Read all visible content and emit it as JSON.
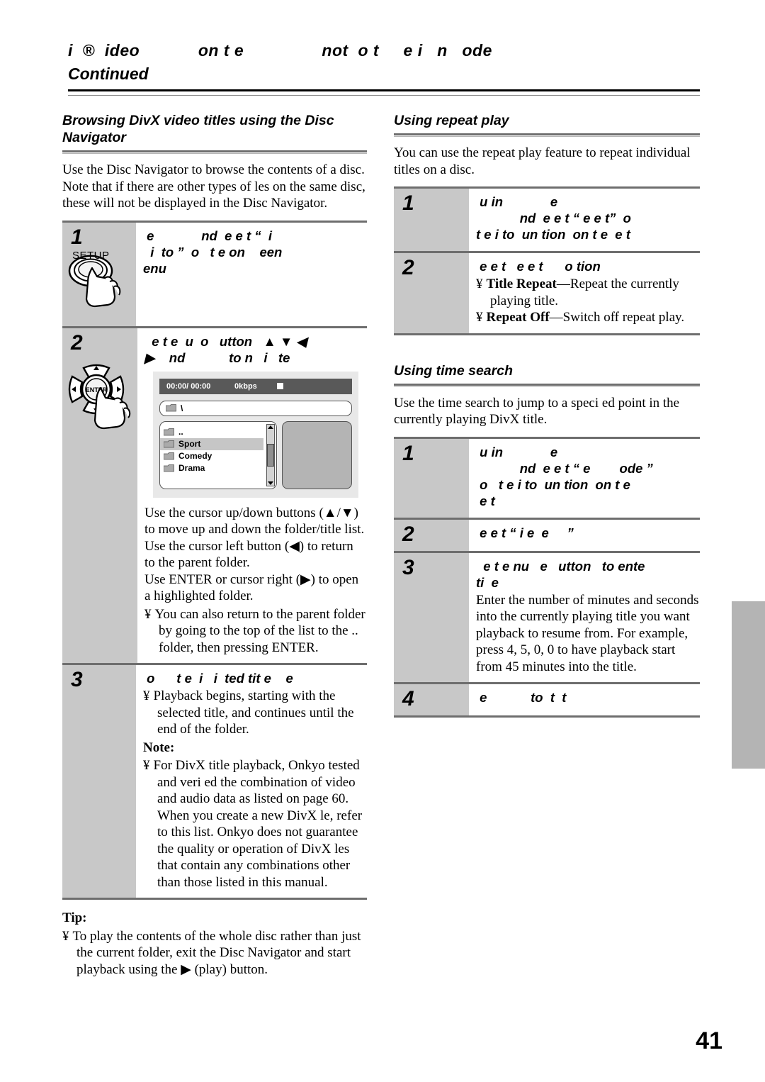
{
  "running_head": {
    "line1": "i  ®  ideo            on t e                not  o t     e i   n   ode",
    "line2": "Continued"
  },
  "left_column": {
    "section_title": "Browsing DivX video titles using the Disc Navigator",
    "intro": "Use the Disc Navigator to browse the contents of a disc. Note that if there are other types of  les on the same disc, these will not be displayed in the Disc Navigator.",
    "steps": [
      {
        "number": "1",
        "button_label": "SETUP",
        "instruction": " e             nd  e e t “  i\n  i  to ”  o   t e on    een\nenu"
      },
      {
        "number": "2",
        "instruction": "  e t e  u  o   utton   ▲ ▼ ◀\n▶    nd            to n   i   te",
        "osd": {
          "status_time": "00:00/ 00:00",
          "status_bitrate": "0kbps",
          "status_icon": "stop-icon",
          "path": "\\",
          "items": [
            {
              "label": "..",
              "selected": false
            },
            {
              "label": "Sport",
              "selected": true
            },
            {
              "label": "Comedy",
              "selected": false
            },
            {
              "label": "Drama",
              "selected": false
            }
          ]
        },
        "paragraphs": [
          "Use the cursor up/down buttons (▲/▼) to move up and down the folder/title list.",
          "Use the cursor left button (◀) to return to the parent folder.",
          "Use ENTER or cursor right (▶) to open a highlighted folder."
        ],
        "bullets": [
          "You can also return to the top of the list to the  .. folder, then pressing ENTER."
        ],
        "bullets_real": [
          "You can also return to the parent folder by going to the top of the list to the  .. folder, then pressing ENTER."
        ]
      },
      {
        "number": "3",
        "instruction": " o      t e  i   i  ted tit e    e",
        "bullets": [
          "Playback begins, starting with the selected title, and continues until the end of the folder."
        ],
        "note_heading": "Note:",
        "note_bullets": [
          "For DivX title playback, Onkyo tested and veri  ed the combination of video and audio data as listed on page 60. When you create a new DivX   le, refer to this list. Onkyo does not guarantee the quality or operation of DivX   les that contain any combinations other than those listed in this manual."
        ]
      }
    ],
    "tip_heading": "Tip:",
    "tip_bullets": [
      "To play the contents of the whole disc rather than just the current folder, exit the Disc Navigator and start playback using the ▶ (play) button."
    ]
  },
  "right_column": {
    "repeat": {
      "section_title": "Using repeat play",
      "intro": "You can use the repeat play feature to repeat individual titles on a disc.",
      "steps": [
        {
          "number": "1",
          "instruction": " u in             e\n            nd  e e t “ e e t”  o\nt e i to  un tion  on t e  e t"
        },
        {
          "number": "2",
          "instruction": " e e t   e e t      o tion",
          "bullets": [
            {
              "term": "Title Repeat",
              "dash": "—",
              "text": "Repeat the currently playing title."
            },
            {
              "term": "Repeat Off",
              "dash": "—",
              "text": "Switch off repeat play."
            }
          ]
        }
      ]
    },
    "timesearch": {
      "section_title": "Using time search",
      "intro": "Use the time search to jump to a speci  ed point in the currently playing DivX title.",
      "steps": [
        {
          "number": "1",
          "instruction": " u in             e\n            nd  e e t “ e        ode ”\n o   t e i to  un tion  on t e\n e t"
        },
        {
          "number": "2",
          "instruction": " e e t “ i e  e     ”"
        },
        {
          "number": "3",
          "instruction": "  e t e nu   e   utton   to ente\nti  e",
          "paragraph": "Enter the number of minutes and seconds into the currently playing title you want playback to resume from. For example, press 4, 5, 0, 0 to have playback start from 45 minutes into the title."
        },
        {
          "number": "4",
          "instruction": " e            to  t  t"
        }
      ]
    }
  },
  "folio": "41",
  "bullet_char": "¥",
  "colors": {
    "step_number_bg": "#c8c8c8",
    "rule": "#6e6e6e",
    "osd_bar": "#595959",
    "side_tab": "#b4b4b4"
  }
}
